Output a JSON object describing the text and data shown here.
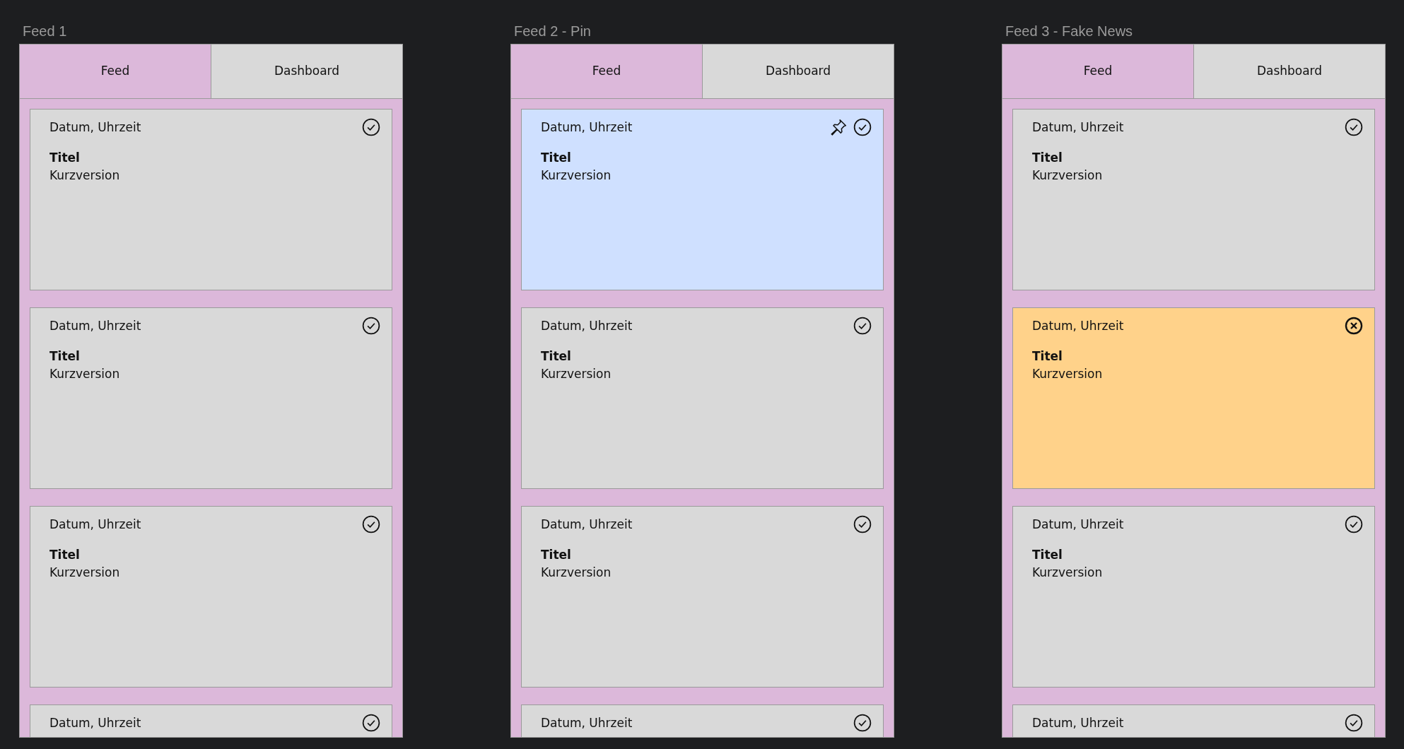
{
  "feeds": [
    {
      "label": "Feed 1",
      "tabs": [
        {
          "label": "Feed",
          "selected": true
        },
        {
          "label": "Dashboard",
          "selected": false
        }
      ],
      "cards": [
        {
          "date": "Datum, Uhrzeit",
          "title": "Titel",
          "summary": "Kurzversion",
          "pinned": false,
          "fake": false
        },
        {
          "date": "Datum, Uhrzeit",
          "title": "Titel",
          "summary": "Kurzversion",
          "pinned": false,
          "fake": false
        },
        {
          "date": "Datum, Uhrzeit",
          "title": "Titel",
          "summary": "Kurzversion",
          "pinned": false,
          "fake": false
        },
        {
          "date": "Datum, Uhrzeit",
          "pinned": false,
          "fake": false
        }
      ]
    },
    {
      "label": "Feed 2 - Pin",
      "tabs": [
        {
          "label": "Feed",
          "selected": true
        },
        {
          "label": "Dashboard",
          "selected": false
        }
      ],
      "cards": [
        {
          "date": "Datum, Uhrzeit",
          "title": "Titel",
          "summary": "Kurzversion",
          "pinned": true,
          "fake": false
        },
        {
          "date": "Datum, Uhrzeit",
          "title": "Titel",
          "summary": "Kurzversion",
          "pinned": false,
          "fake": false
        },
        {
          "date": "Datum, Uhrzeit",
          "title": "Titel",
          "summary": "Kurzversion",
          "pinned": false,
          "fake": false
        },
        {
          "date": "Datum, Uhrzeit",
          "pinned": false,
          "fake": false
        }
      ]
    },
    {
      "label": "Feed 3 - Fake News",
      "tabs": [
        {
          "label": "Feed",
          "selected": true
        },
        {
          "label": "Dashboard",
          "selected": false
        }
      ],
      "cards": [
        {
          "date": "Datum, Uhrzeit",
          "title": "Titel",
          "summary": "Kurzversion",
          "pinned": false,
          "fake": false
        },
        {
          "date": "Datum, Uhrzeit",
          "title": "Titel",
          "summary": "Kurzversion",
          "pinned": false,
          "fake": true
        },
        {
          "date": "Datum, Uhrzeit",
          "title": "Titel",
          "summary": "Kurzversion",
          "pinned": false,
          "fake": false
        },
        {
          "date": "Datum, Uhrzeit",
          "pinned": false,
          "fake": false
        }
      ]
    }
  ]
}
